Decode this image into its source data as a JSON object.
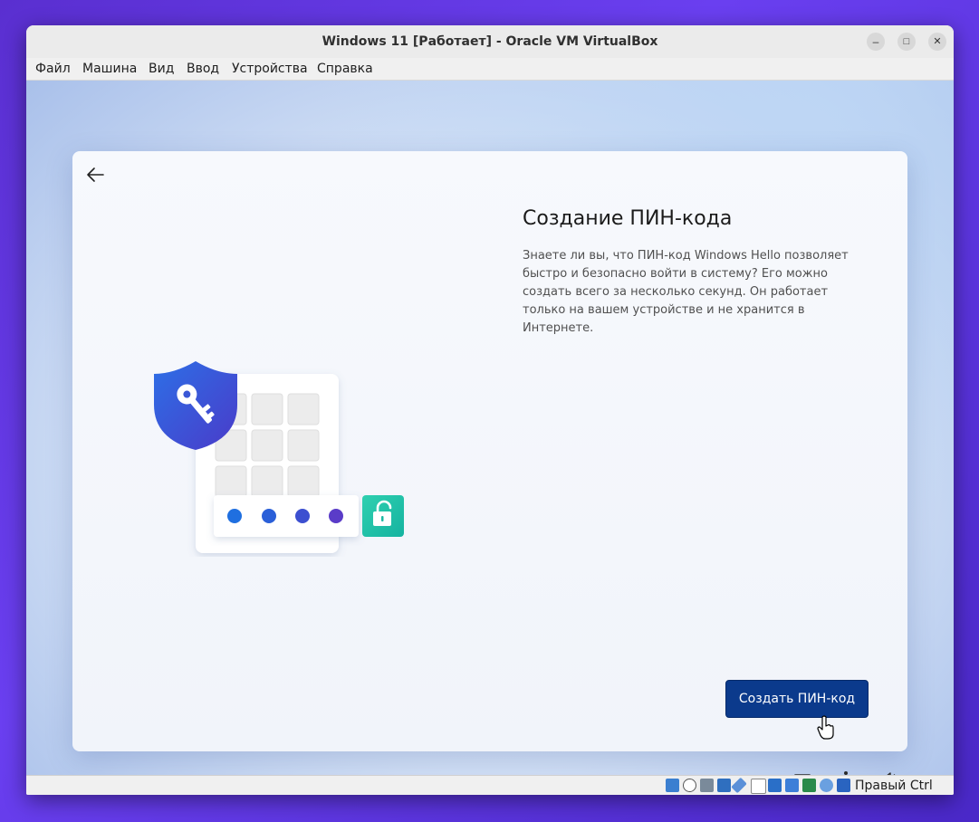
{
  "window": {
    "title": "Windows 11 [Работает] - Oracle VM VirtualBox",
    "controls": {
      "minimize": "–",
      "maximize": "□",
      "close": "✕"
    }
  },
  "menu": {
    "items": [
      "Файл",
      "Машина",
      "Вид",
      "Ввод",
      "Устройства",
      "Справка"
    ]
  },
  "oobe": {
    "heading": "Создание ПИН-кода",
    "description": "Знаете ли вы, что ПИН-код Windows Hello позволяет быстро и безопасно войти в систему? Его можно создать всего за несколько секунд. Он работает только на вашем устройстве и не хранится в Интернете.",
    "primary_button": "Создать ПИН-код",
    "illustration": {
      "pin_dot_colors": [
        "#1f6fe0",
        "#2a5fd8",
        "#3c4fd0",
        "#5a3cc8"
      ],
      "shield_color": "#2f4fd6",
      "unlock_tile_color": "#1ec2a6"
    }
  },
  "taskbar_icons": [
    "keyboard-icon",
    "accessibility-icon",
    "volume-icon"
  ],
  "statusbar": {
    "host_key": "Правый Ctrl",
    "icons": [
      "hdd-icon",
      "optical-disk-icon",
      "audio-icon",
      "network-icon",
      "usb-icon",
      "shared-folder-icon",
      "display-icon",
      "video-capture-icon",
      "recording-icon",
      "cpu-icon",
      "mouse-integration-icon",
      "keyboard-capture-icon"
    ]
  }
}
